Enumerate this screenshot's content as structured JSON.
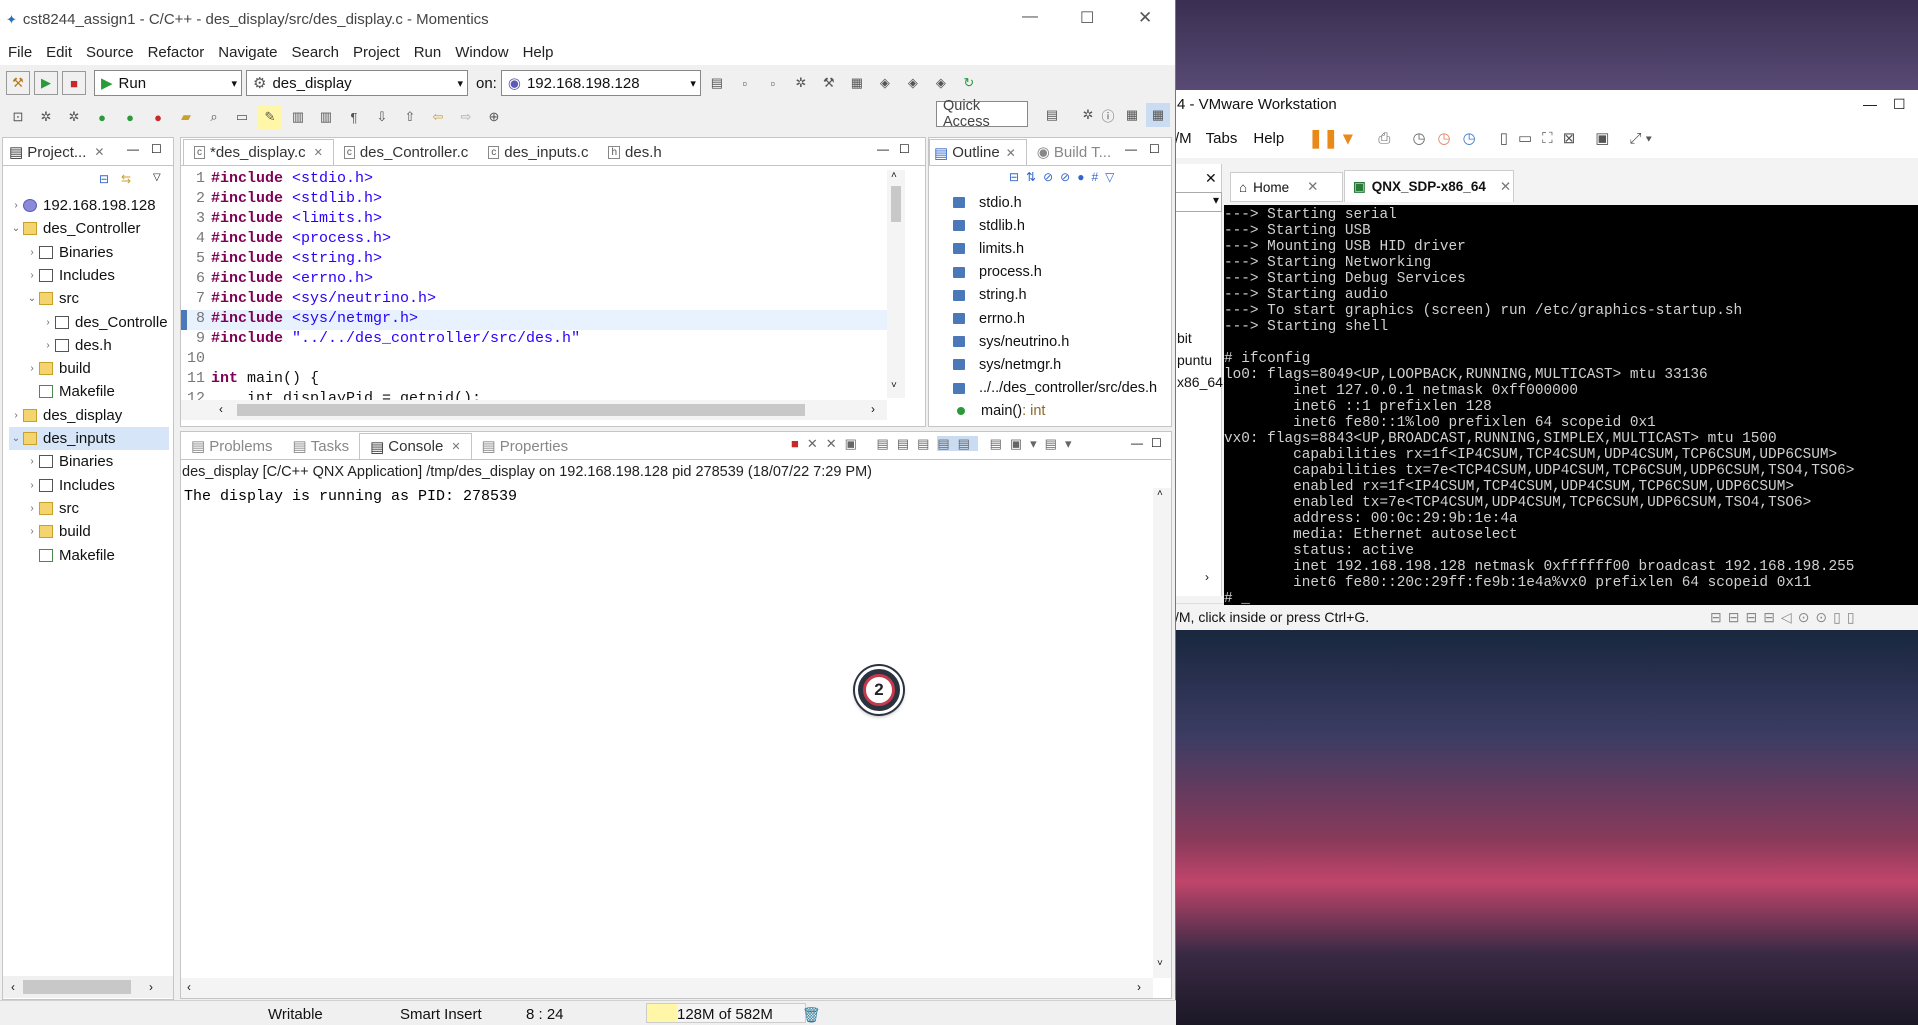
{
  "eclipse": {
    "title": "cst8244_assign1 - C/C++ - des_display/src/des_display.c - Momentics",
    "menu": [
      "File",
      "Edit",
      "Source",
      "Refactor",
      "Navigate",
      "Search",
      "Project",
      "Run",
      "Window",
      "Help"
    ],
    "launch_mode": "Run",
    "launch_config": "des_display",
    "on_label": "on:",
    "target": "192.168.198.128",
    "quick_access": "Quick Access",
    "project_view": {
      "tab": "Project...",
      "items": [
        {
          "label": "192.168.198.128",
          "indent": 0,
          "arrow": "›",
          "icon": "target"
        },
        {
          "label": "des_Controller",
          "indent": 0,
          "arrow": "⌄",
          "icon": "project"
        },
        {
          "label": "Binaries",
          "indent": 1,
          "arrow": "›",
          "icon": "binaries"
        },
        {
          "label": "Includes",
          "indent": 1,
          "arrow": "›",
          "icon": "includes"
        },
        {
          "label": "src",
          "indent": 1,
          "arrow": "⌄",
          "icon": "folder"
        },
        {
          "label": "des_Controllе",
          "indent": 2,
          "arrow": "›",
          "icon": "cfile"
        },
        {
          "label": "des.h",
          "indent": 2,
          "arrow": "›",
          "icon": "hfile"
        },
        {
          "label": "build",
          "indent": 1,
          "arrow": "›",
          "icon": "folder"
        },
        {
          "label": "Makefile",
          "indent": 1,
          "arrow": "",
          "icon": "makefile"
        },
        {
          "label": "des_display",
          "indent": 0,
          "arrow": "›",
          "icon": "project"
        },
        {
          "label": "des_inputs",
          "indent": 0,
          "arrow": "⌄",
          "icon": "project"
        },
        {
          "label": "Binaries",
          "indent": 1,
          "arrow": "›",
          "icon": "binaries"
        },
        {
          "label": "Includes",
          "indent": 1,
          "arrow": "›",
          "icon": "includes"
        },
        {
          "label": "src",
          "indent": 1,
          "arrow": "›",
          "icon": "folder"
        },
        {
          "label": "build",
          "indent": 1,
          "arrow": "›",
          "icon": "folder"
        },
        {
          "label": "Makefile",
          "indent": 1,
          "arrow": "",
          "icon": "makefile"
        }
      ]
    },
    "editor": {
      "tabs": [
        "*des_display.c",
        "des_Controller.c",
        "des_inputs.c",
        "des.h"
      ],
      "lines": [
        {
          "n": "1",
          "kw": "#include",
          "rest": " <stdio.h>"
        },
        {
          "n": "2",
          "kw": "#include",
          "rest": " <stdlib.h>"
        },
        {
          "n": "3",
          "kw": "#include",
          "rest": " <limits.h>"
        },
        {
          "n": "4",
          "kw": "#include",
          "rest": " <process.h>"
        },
        {
          "n": "5",
          "kw": "#include",
          "rest": " <string.h>"
        },
        {
          "n": "6",
          "kw": "#include",
          "rest": " <errno.h>"
        },
        {
          "n": "7",
          "kw": "#include",
          "rest": " <sys/neutrino.h>"
        },
        {
          "n": "8",
          "kw": "#include",
          "rest": " <sys/netmgr.h>"
        },
        {
          "n": "9",
          "kw": "#include",
          "rest": " \"../../des_controller/src/des.h\""
        },
        {
          "n": "10",
          "kw": "",
          "rest": ""
        },
        {
          "n": "11",
          "kw": "int",
          "rest": " main() {"
        },
        {
          "n": "12",
          "kw": "",
          "rest": "    int displayPid = getpid();"
        }
      ]
    },
    "outline": {
      "tabs": [
        "Outline",
        "Build T..."
      ],
      "items": [
        "stdio.h",
        "stdlib.h",
        "limits.h",
        "process.h",
        "string.h",
        "errno.h",
        "sys/neutrino.h",
        "sys/netmgr.h",
        "../../des_controller/src/des.h"
      ],
      "main_label": "main()",
      "main_type": " : int"
    },
    "console": {
      "tabs": [
        "Problems",
        "Tasks",
        "Console",
        "Properties"
      ],
      "header": "des_display [C/C++ QNX Application] /tmp/des_display on 192.168.198.128 pid 278539 (18/07/22 7:29 PM)",
      "output": "The display is running as PID: 278539"
    },
    "status": {
      "writable": "Writable",
      "insert_mode": "Smart Insert",
      "position": "8 : 24",
      "heap": "128M of 582M"
    },
    "badge": "2"
  },
  "vmware": {
    "title": "4 - VMware Workstation",
    "menu": [
      "/M",
      "Tabs",
      "Help"
    ],
    "lib_items": [
      "bit",
      "puntu",
      "x86_64"
    ],
    "tabs": [
      "Home",
      "QNX_SDP-x86_64"
    ],
    "terminal": [
      "---> Starting serial",
      "---> Starting USB",
      "---> Mounting USB HID driver",
      "---> Starting Networking",
      "---> Starting Debug Services",
      "---> Starting audio",
      "---> To start graphics (screen) run /etc/graphics-startup.sh",
      "---> Starting shell",
      "",
      "# ifconfig",
      "lo0: flags=8049<UP,LOOPBACK,RUNNING,MULTICAST> mtu 33136",
      "        inet 127.0.0.1 netmask 0xff000000",
      "        inet6 ::1 prefixlen 128",
      "        inet6 fe80::1%lo0 prefixlen 64 scopeid 0x1",
      "vx0: flags=8843<UP,BROADCAST,RUNNING,SIMPLEX,MULTICAST> mtu 1500",
      "        capabilities rx=1f<IP4CSUM,TCP4CSUM,UDP4CSUM,TCP6CSUM,UDP6CSUM>",
      "        capabilities tx=7e<TCP4CSUM,UDP4CSUM,TCP6CSUM,UDP6CSUM,TSO4,TSO6>",
      "        enabled rx=1f<IP4CSUM,TCP4CSUM,UDP4CSUM,TCP6CSUM,UDP6CSUM>",
      "        enabled tx=7e<TCP4CSUM,UDP4CSUM,TCP6CSUM,UDP6CSUM,TSO4,TSO6>",
      "        address: 00:0c:29:9b:1e:4a",
      "        media: Ethernet autoselect",
      "        status: active",
      "        inet 192.168.198.128 netmask 0xffffff00 broadcast 192.168.198.255",
      "        inet6 fe80::20c:29ff:fe9b:1e4a%vx0 prefixlen 64 scopeid 0x11",
      "# _"
    ],
    "status_hint": "/M, click inside or press Ctrl+G."
  }
}
